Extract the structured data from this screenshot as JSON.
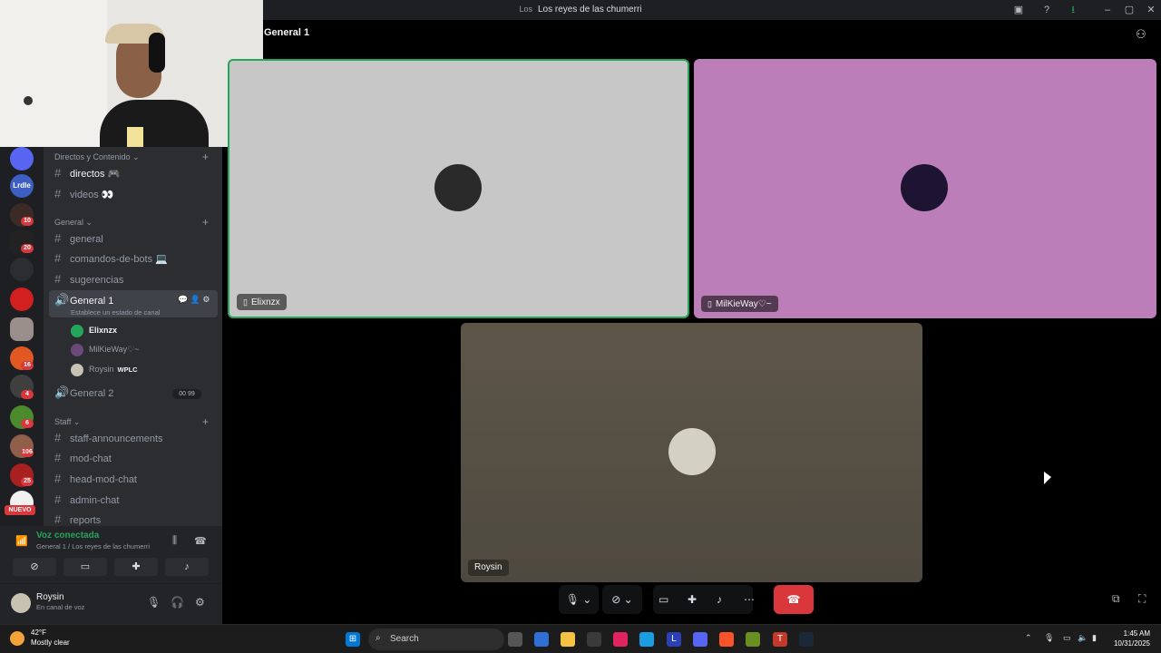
{
  "window": {
    "title": "Los reyes de las chumerri",
    "title_prefix": "Los"
  },
  "call": {
    "channel_title": "General 1",
    "tiles": [
      {
        "name": "Elixnzx",
        "bg": "#c7c7c7",
        "speaking": true
      },
      {
        "name": "MilKieWay♡~",
        "bg": "#bb7eb8",
        "speaking": false
      },
      {
        "name": "Roysin",
        "bg": "#5d5648",
        "speaking": false
      }
    ],
    "controls": {
      "mic_icon": "microphone-icon",
      "camera_icon": "camera-off-icon",
      "screen_share_icon": "screen-share-icon",
      "activities_icon": "activities-icon",
      "soundboard_icon": "soundboard-icon",
      "more_icon": "more-icon",
      "leave_icon": "phone-hangup-icon"
    }
  },
  "sidebar": {
    "categories": {
      "streams": "Directos y Contenido",
      "general": "General",
      "staff": "Staff"
    },
    "channels": {
      "directos": "directos 🎮",
      "videos": "videos 👀",
      "general": "general",
      "bots": "comandos-de-bots 💻",
      "sugerencias": "sugerencias",
      "general1": "General 1",
      "general1_status": "Establece un estado de canal",
      "general2": "General 2",
      "general2_count": "00  99",
      "staff_ann": "staff-announcements",
      "mod_chat": "mod-chat",
      "head_mod_chat": "head-mod-chat",
      "admin_chat": "admin-chat",
      "reports": "reports"
    },
    "voice_users": [
      {
        "name": "Elixnzx",
        "tag": ""
      },
      {
        "name": "MilKieWay♡~",
        "tag": ""
      },
      {
        "name": "Roysin",
        "tag": "WPLC"
      }
    ]
  },
  "rail": {
    "badges": [
      "10",
      "20",
      "16",
      "4",
      "6",
      "106",
      "25"
    ],
    "server_label": "Lrdle",
    "new_badge": "NUEVO"
  },
  "voice_panel": {
    "status": "Voz conectada",
    "location": "General 1 / Los reyes de las chumerri"
  },
  "user_panel": {
    "name": "Roysin",
    "status": "En canal de voz"
  },
  "taskbar": {
    "temp": "42°F",
    "weather": "Mostly clear",
    "search_placeholder": "Search",
    "time": "1:45 AM",
    "date": "10/31/2025"
  },
  "colors": {
    "accent_green": "#23a55a",
    "danger_red": "#da373c",
    "sidebar_bg": "#2b2d31",
    "rail_bg": "#1e1f22"
  }
}
